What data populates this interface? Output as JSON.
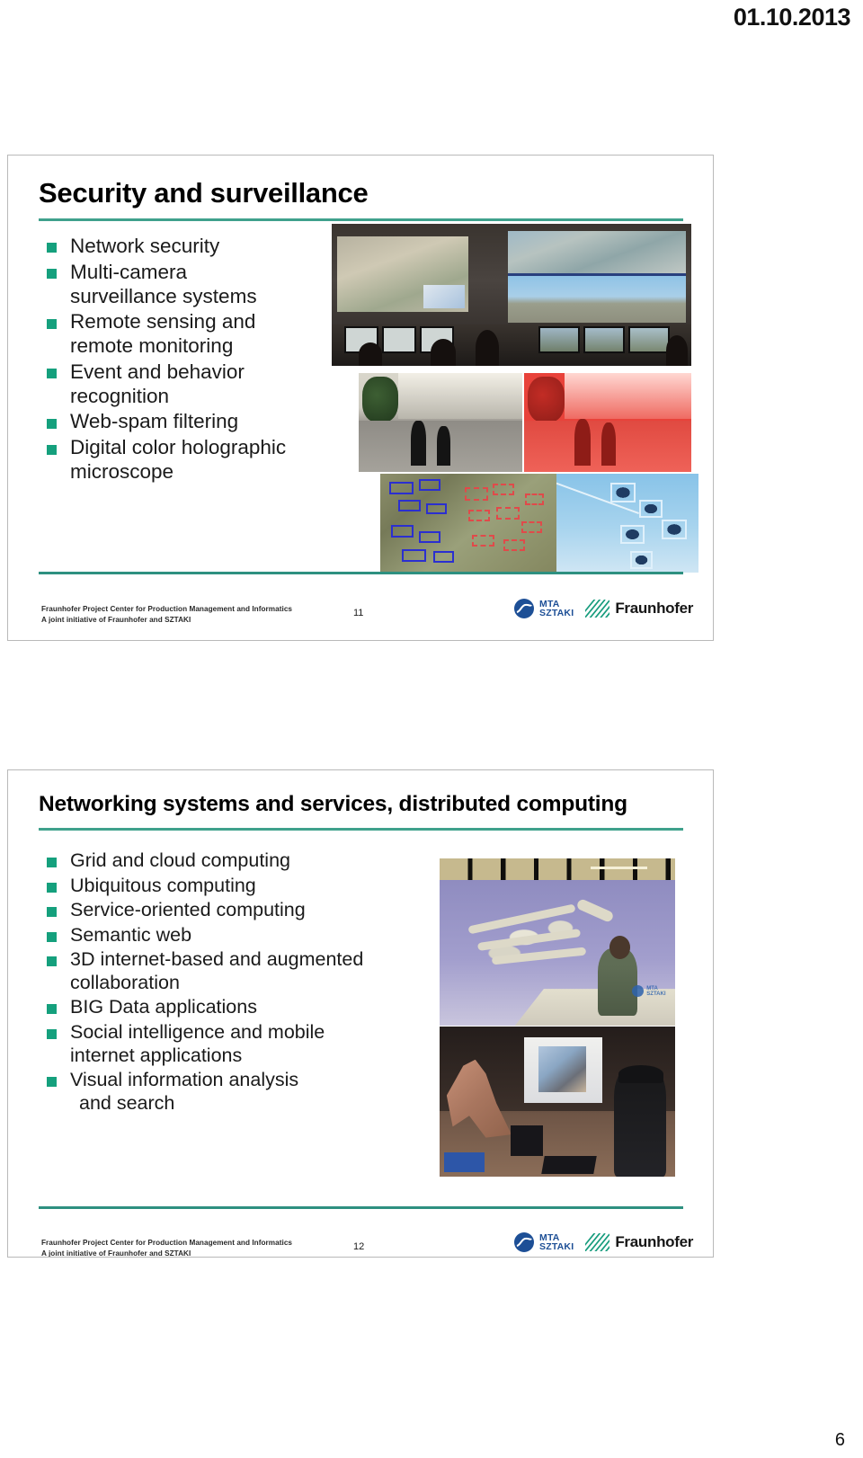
{
  "document": {
    "date": "01.10.2013",
    "page_number": "6"
  },
  "slides": [
    {
      "title": "Security and surveillance",
      "bullets": [
        {
          "line1": "Network security",
          "line2": ""
        },
        {
          "line1": "Multi-camera",
          "line2": "surveillance systems"
        },
        {
          "line1": "Remote sensing and",
          "line2": "remote monitoring"
        },
        {
          "line1": "Event and behavior",
          "line2": "recognition"
        },
        {
          "line1": "Web-spam filtering",
          "line2": ""
        },
        {
          "line1": "Digital color holographic",
          "line2": "microscope"
        }
      ],
      "footer": {
        "line1": "Fraunhofer Project Center for Production Management and Informatics",
        "line2": "A joint initiative of Fraunhofer and SZTAKI",
        "slide_number": "11",
        "logos": [
          {
            "name": "mta-sztaki-logo",
            "line1": "MTA",
            "line2": "SZTAKI"
          },
          {
            "name": "fraunhofer-logo",
            "text": "Fraunhofer"
          }
        ]
      },
      "images": [
        {
          "name": "control-room-photo"
        },
        {
          "name": "pedestrian-surveillance-photo"
        },
        {
          "name": "pedestrian-thermal-detection-photo"
        },
        {
          "name": "aerial-building-detection-photo"
        },
        {
          "name": "aircraft-detection-sky-photo"
        }
      ]
    },
    {
      "title": "Networking systems and services, distributed computing",
      "bullets": [
        {
          "line1": "Grid and cloud computing",
          "line2": ""
        },
        {
          "line1": "Ubiquitous computing",
          "line2": ""
        },
        {
          "line1": "Service-oriented computing",
          "line2": ""
        },
        {
          "line1": "Semantic web",
          "line2": ""
        },
        {
          "line1": "3D internet-based and augmented",
          "line2": "collaboration"
        },
        {
          "line1": "BIG Data applications",
          "line2": ""
        },
        {
          "line1": "Social intelligence and mobile",
          "line2": "internet applications"
        },
        {
          "line1": "Visual information analysis",
          "line2": "and search"
        }
      ],
      "footer": {
        "line1": "Fraunhofer Project Center for Production Management and Informatics",
        "line2": "A joint initiative of Fraunhofer and SZTAKI",
        "slide_number": "12",
        "logos": [
          {
            "name": "mta-sztaki-logo",
            "line1": "MTA",
            "line2": "SZTAKI"
          },
          {
            "name": "fraunhofer-logo",
            "text": "Fraunhofer"
          }
        ]
      },
      "images": [
        {
          "name": "vr-cave-3d-model-photo",
          "watermark_line1": "MTA",
          "watermark_line2": "SZTAKI"
        },
        {
          "name": "vr-robot-augmented-collaboration-photo"
        }
      ]
    }
  ],
  "colors": {
    "accent_green": "#15a07d",
    "rule_green": "#2e9080",
    "fraunhofer_green": "#179c7d",
    "mta_blue": "#1d4f96",
    "text_dark": "#1a1a1a"
  }
}
